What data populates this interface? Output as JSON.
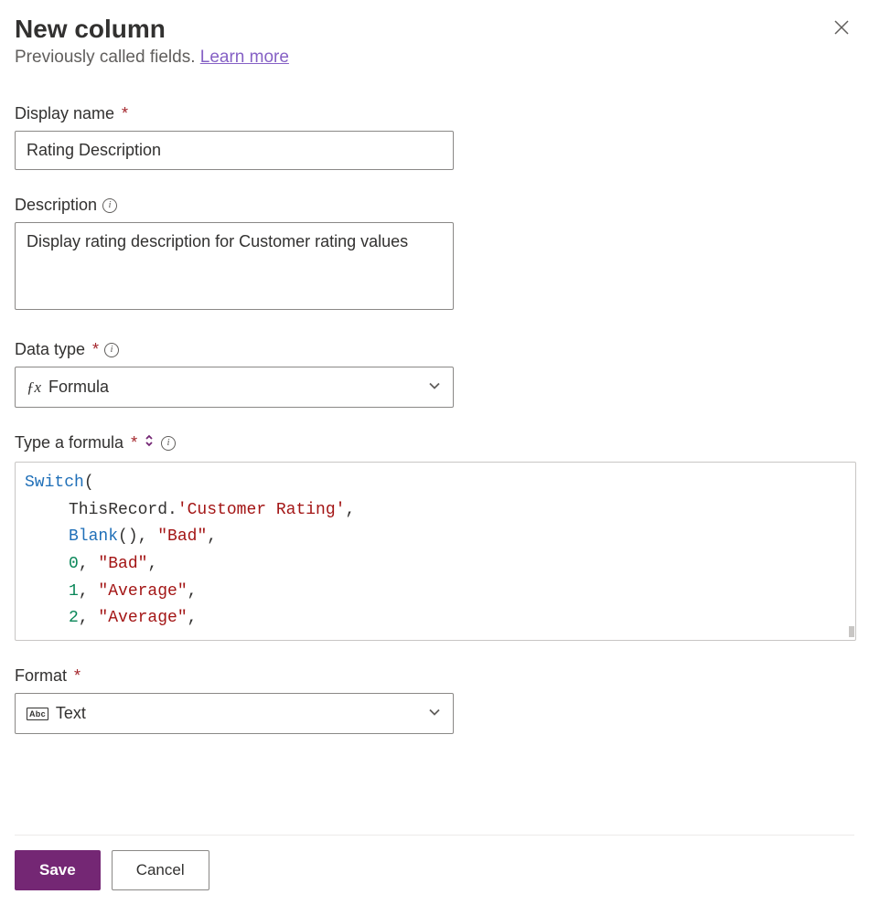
{
  "header": {
    "title": "New column",
    "subtitle_prefix": "Previously called fields. ",
    "learn_more": "Learn more"
  },
  "fields": {
    "display_name": {
      "label": "Display name",
      "value": "Rating Description"
    },
    "description": {
      "label": "Description",
      "value": "Display rating description for Customer rating values"
    },
    "data_type": {
      "label": "Data type",
      "selected": "Formula"
    },
    "formula": {
      "label": "Type a formula",
      "tokens": [
        [
          {
            "t": "Switch",
            "c": "kw"
          },
          {
            "t": "(",
            "c": "plain"
          }
        ],
        [
          {
            "t": "ThisRecord.",
            "c": "plain"
          },
          {
            "t": "'Customer Rating'",
            "c": "str"
          },
          {
            "t": ",",
            "c": "plain"
          }
        ],
        [
          {
            "t": "Blank",
            "c": "kw"
          },
          {
            "t": "(), ",
            "c": "plain"
          },
          {
            "t": "\"Bad\"",
            "c": "str"
          },
          {
            "t": ",",
            "c": "plain"
          }
        ],
        [
          {
            "t": "0",
            "c": "num"
          },
          {
            "t": ", ",
            "c": "plain"
          },
          {
            "t": "\"Bad\"",
            "c": "str"
          },
          {
            "t": ",",
            "c": "plain"
          }
        ],
        [
          {
            "t": "1",
            "c": "num"
          },
          {
            "t": ", ",
            "c": "plain"
          },
          {
            "t": "\"Average\"",
            "c": "str"
          },
          {
            "t": ",",
            "c": "plain"
          }
        ],
        [
          {
            "t": "2",
            "c": "num"
          },
          {
            "t": ", ",
            "c": "plain"
          },
          {
            "t": "\"Average\"",
            "c": "str"
          },
          {
            "t": ",",
            "c": "plain"
          }
        ]
      ]
    },
    "format": {
      "label": "Format",
      "selected": "Text"
    }
  },
  "footer": {
    "save": "Save",
    "cancel": "Cancel"
  }
}
